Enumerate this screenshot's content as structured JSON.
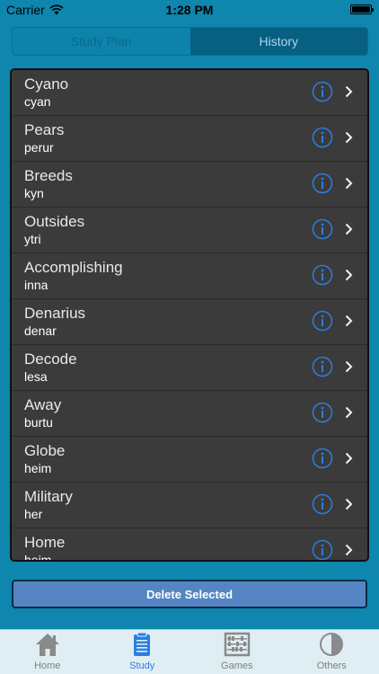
{
  "status": {
    "carrier": "Carrier",
    "time": "1:28 PM"
  },
  "segments": [
    {
      "label": "Study Plan",
      "active": false
    },
    {
      "label": "History",
      "active": true
    }
  ],
  "list": [
    {
      "word": "Cyano",
      "translation": "cyan"
    },
    {
      "word": "Pears",
      "translation": "perur"
    },
    {
      "word": "Breeds",
      "translation": "kyn"
    },
    {
      "word": "Outsides",
      "translation": "ytri"
    },
    {
      "word": "Accomplishing",
      "translation": "inna"
    },
    {
      "word": "Denarius",
      "translation": "denar"
    },
    {
      "word": "Decode",
      "translation": "lesa"
    },
    {
      "word": "Away",
      "translation": "burtu"
    },
    {
      "word": "Globe",
      "translation": "heim"
    },
    {
      "word": "Military",
      "translation": "her"
    },
    {
      "word": "Home",
      "translation": "heim"
    }
  ],
  "delete_button": {
    "label": "Delete Selected"
  },
  "tabbar": [
    {
      "label": "Home",
      "icon": "home-icon",
      "active": false
    },
    {
      "label": "Study",
      "icon": "clipboard-icon",
      "active": true
    },
    {
      "label": "Games",
      "icon": "abacus-icon",
      "active": false
    },
    {
      "label": "Others",
      "icon": "half-circle-icon",
      "active": false
    }
  ],
  "colors": {
    "background": "#0e86ad",
    "accent": "#2b7ee0",
    "list_bg": "#3a3a3a",
    "button": "#5585c2"
  }
}
